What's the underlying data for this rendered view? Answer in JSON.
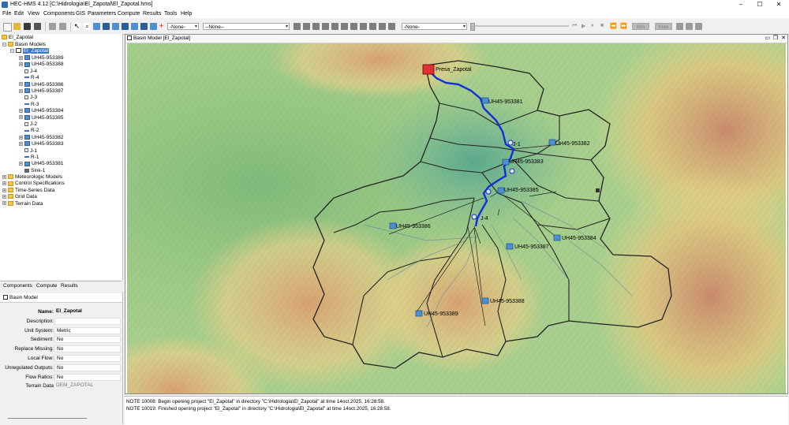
{
  "window": {
    "title": "HEC-HMS 4.12 [C:\\Hidrologia\\El_Zapotal\\El_Zapotal.hms]"
  },
  "menu": [
    "File",
    "Edit",
    "View",
    "Components",
    "GIS",
    "Parameters",
    "Compute",
    "Results",
    "Tools",
    "Help"
  ],
  "toolbar": {
    "combo1": "-None-",
    "combo2": "--None--",
    "combo3": "-None-",
    "btn_min": "Min",
    "btn_max": "Max"
  },
  "tree": {
    "root": "El_Zapotal",
    "basin_models": "Basin Models",
    "selected": "El_Zapotal",
    "elements": [
      {
        "label": "UH45-953389",
        "type": "sub"
      },
      {
        "label": "UH45-953388",
        "type": "sub"
      },
      {
        "label": "J-4",
        "type": "jct"
      },
      {
        "label": "R-4",
        "type": "rch"
      },
      {
        "label": "UH45-953386",
        "type": "sub"
      },
      {
        "label": "UH45-953387",
        "type": "sub"
      },
      {
        "label": "J-3",
        "type": "jct"
      },
      {
        "label": "R-3",
        "type": "rch"
      },
      {
        "label": "UH45-953384",
        "type": "sub"
      },
      {
        "label": "UH45-953385",
        "type": "sub"
      },
      {
        "label": "J-2",
        "type": "jct"
      },
      {
        "label": "R-2",
        "type": "rch"
      },
      {
        "label": "UH45-953382",
        "type": "sub"
      },
      {
        "label": "UH45-953383",
        "type": "sub"
      },
      {
        "label": "J-1",
        "type": "jct"
      },
      {
        "label": "R-1",
        "type": "rch"
      },
      {
        "label": "UH45-953381",
        "type": "sub"
      },
      {
        "label": "Sink-1",
        "type": "snk"
      }
    ],
    "other_folders": [
      "Meteorologic Models",
      "Control Specifications",
      "Time-Series Data",
      "Grid Data",
      "Terrain Data"
    ]
  },
  "tabs": [
    "Components",
    "Compute",
    "Results"
  ],
  "properties": {
    "header": "Basin Model",
    "rows": [
      {
        "label": "Name:",
        "value": "El_Zapotal",
        "bold": true
      },
      {
        "label": "Description:",
        "value": ""
      },
      {
        "label": "Unit System:",
        "value": "Metric"
      },
      {
        "label": "Sediment:",
        "value": "No"
      },
      {
        "label": "Replace Missing:",
        "value": "No"
      },
      {
        "label": "Local Flow:",
        "value": "No"
      },
      {
        "label": "Unregulated Outputs:",
        "value": "No"
      },
      {
        "label": "Flow Ratios:",
        "value": "No"
      },
      {
        "label": "Terrain Data",
        "value": "DEM_ZAPOTAL"
      }
    ]
  },
  "map_window": {
    "title": "Basin Model [El_Zapotal]"
  },
  "map_labels": {
    "outlet": "Presa_Zapotal",
    "s1": "UH45-953381",
    "s2": "UH45-953382",
    "s3": "UH45-953383",
    "s5": "UH45-953385",
    "s6": "UH45-953386",
    "s4": "UH45-953384",
    "s7": "UH45-953387",
    "s8": "UH45-953388",
    "s9": "UH45-953389",
    "j1": "J-1",
    "j4": "J-4"
  },
  "log": [
    "NOTE 10008:  Begin opening project \"El_Zapotal\" in directory \"C:\\Hidrologia\\El_Zapotal\" at time 14oct.2025, 16:28:58.",
    "NOTE 10019:  Finished opening project \"El_Zapotal\" in directory \"C:\\Hidrologia\\El_Zapotal\" at time 14oct.2025, 16:28:58."
  ],
  "colors": {
    "reach": "#1330d8",
    "selection": "#3478c8",
    "boundary": "#222222"
  }
}
